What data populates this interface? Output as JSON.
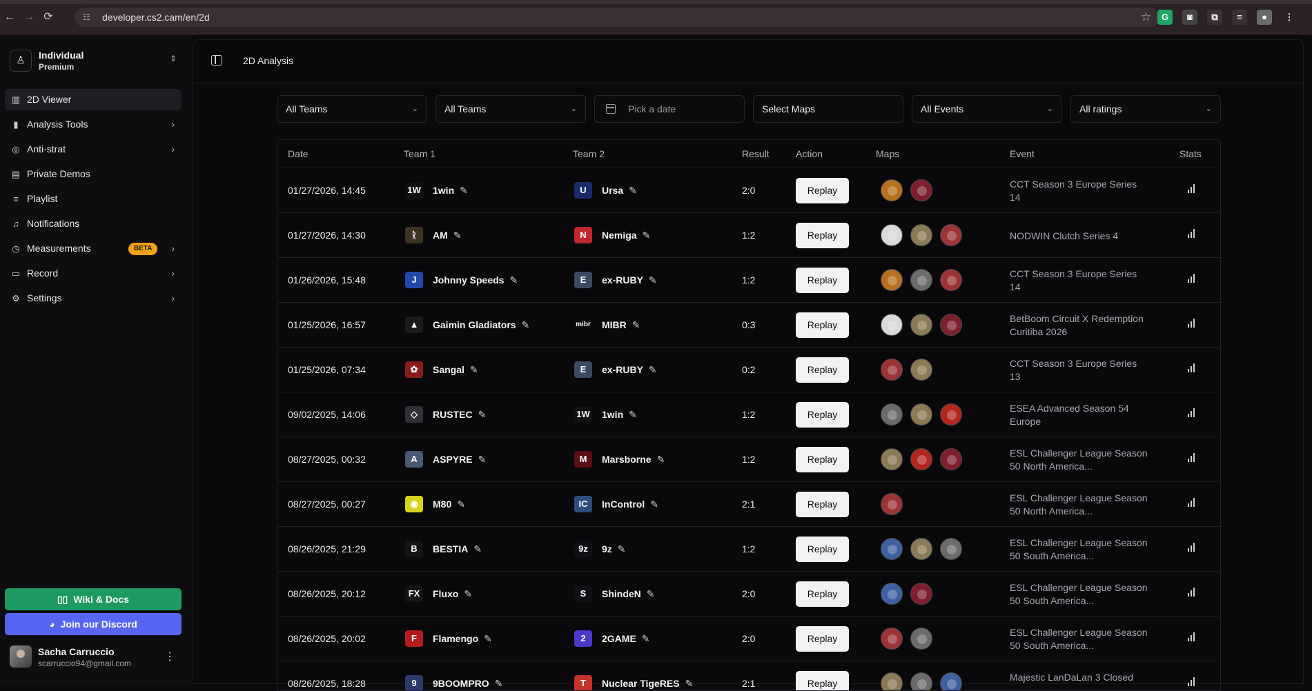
{
  "browser": {
    "url": "developer.cs2.cam/en/2d",
    "back_icon": "←",
    "forward_icon": "→",
    "reload_icon": "⟳",
    "extensions": [
      {
        "name": "grammarly-icon",
        "glyph": "G",
        "color": "#1fa463"
      },
      {
        "name": "extension-shield-icon",
        "glyph": "◙",
        "color": "#444444"
      },
      {
        "name": "puzzle-icon",
        "glyph": "⧉",
        "color": "#3a2f33"
      },
      {
        "name": "media-icon",
        "glyph": "≡",
        "color": "#3a2f33"
      },
      {
        "name": "profile-icon",
        "glyph": "●",
        "color": "#6a6a6a"
      },
      {
        "name": "kebab-icon",
        "glyph": "⋮",
        "color": "#2a2225"
      }
    ]
  },
  "account": {
    "name": "Individual",
    "plan": "Premium"
  },
  "menu": [
    {
      "label": "2D Viewer",
      "icon": "▥",
      "icon_name": "map-icon",
      "active": true,
      "arrow": false
    },
    {
      "label": "Analysis Tools",
      "icon": "▮",
      "icon_name": "chart-icon",
      "active": false,
      "arrow": true
    },
    {
      "label": "Anti-strat",
      "icon": "◎",
      "icon_name": "target-icon",
      "active": false,
      "arrow": true
    },
    {
      "label": "Private Demos",
      "icon": "▤",
      "icon_name": "document-icon",
      "active": false,
      "arrow": false
    },
    {
      "label": "Playlist",
      "icon": "≡",
      "icon_name": "playlist-icon",
      "active": false,
      "arrow": false
    },
    {
      "label": "Notifications",
      "icon": "♫",
      "icon_name": "bell-icon",
      "active": false,
      "arrow": false
    },
    {
      "label": "Measurements",
      "icon": "◷",
      "icon_name": "timer-icon",
      "active": false,
      "arrow": true,
      "badge": "BETA"
    },
    {
      "label": "Record",
      "icon": "▭",
      "icon_name": "video-icon",
      "active": false,
      "arrow": true
    },
    {
      "label": "Settings",
      "icon": "⚙",
      "icon_name": "settings-icon",
      "active": false,
      "arrow": true
    }
  ],
  "wiki_label": "Wiki & Docs",
  "discord_label": "Join our Discord",
  "user": {
    "name": "Sacha Carruccio",
    "email": "scarruccio94@gmail.com"
  },
  "page_title": "2D Analysis",
  "filters": {
    "team1": "All Teams",
    "team2": "All Teams",
    "date_placeholder": "Pick a date",
    "maps": "Select Maps",
    "events": "All Events",
    "ratings": "All ratings"
  },
  "table": {
    "headers": {
      "date": "Date",
      "team1": "Team 1",
      "team2": "Team 2",
      "result": "Result",
      "action": "Action",
      "maps": "Maps",
      "event": "Event",
      "stats": "Stats"
    },
    "replay_label": "Replay",
    "rows": [
      {
        "date": "01/27/2026, 14:45",
        "team1": "1win",
        "t1logo": "1W",
        "t1color": "#111111",
        "team2": "Ursa",
        "t2logo": "U",
        "t2color": "#1b2a6b",
        "result": "2:0",
        "maps": [
          "#b7701f",
          "#7d1f2c"
        ],
        "event": "CCT Season 3 Europe Series 14"
      },
      {
        "date": "01/27/2026, 14:30",
        "team1": "AM",
        "t1logo": "ᚱ",
        "t1color": "#3d3322",
        "team2": "Nemiga",
        "t2logo": "N",
        "t2color": "#c1272d",
        "result": "1:2",
        "maps": [
          "#d9d9d9",
          "#8a7a55",
          "#9c3336"
        ],
        "event": "NODWIN Clutch Series 4"
      },
      {
        "date": "01/26/2026, 15:48",
        "team1": "Johnny Speeds",
        "t1logo": "J",
        "t1color": "#2347a8",
        "team2": "ex-RUBY",
        "t2logo": "E",
        "t2color": "#3b4a63",
        "result": "1:2",
        "maps": [
          "#b7701f",
          "#6b6b6b",
          "#9c3336"
        ],
        "event": "CCT Season 3 Europe Series 14"
      },
      {
        "date": "01/25/2026, 16:57",
        "team1": "Gaimin Gladiators",
        "t1logo": "▲",
        "t1color": "#1a1a1a",
        "team2": "MIBR",
        "t2logo": "mibr",
        "t2color": "#0a0a0a",
        "result": "0:3",
        "maps": [
          "#d9d9d9",
          "#8a7a55",
          "#7d1f2c"
        ],
        "event": "BetBoom Circuit X Redemption Curitiba 2026"
      },
      {
        "date": "01/25/2026, 07:34",
        "team1": "Sangal",
        "t1logo": "✿",
        "t1color": "#8a1c1c",
        "team2": "ex-RUBY",
        "t2logo": "E",
        "t2color": "#3b4a63",
        "result": "0:2",
        "maps": [
          "#9c3336",
          "#8a7a55"
        ],
        "event": "CCT Season 3 Europe Series 13"
      },
      {
        "date": "09/02/2025, 14:06",
        "team1": "RUSTEC",
        "t1logo": "◇",
        "t1color": "#303036",
        "team2": "1win",
        "t2logo": "1W",
        "t2color": "#111111",
        "result": "1:2",
        "maps": [
          "#6b6b6b",
          "#8a7a55",
          "#b3261e"
        ],
        "event": "ESEA Advanced Season 54 Europe"
      },
      {
        "date": "08/27/2025, 00:32",
        "team1": "ASPYRE",
        "t1logo": "A",
        "t1color": "#4a5876",
        "team2": "Marsborne",
        "t2logo": "M",
        "t2color": "#5a0f14",
        "result": "1:2",
        "maps": [
          "#8a7a55",
          "#b3261e",
          "#7d1f2c"
        ],
        "event": "ESL Challenger League Season 50 North America..."
      },
      {
        "date": "08/27/2025, 00:27",
        "team1": "M80",
        "t1logo": "◉",
        "t1color": "#d7d21a",
        "team2": "InControl",
        "t2logo": "IC",
        "t2color": "#2f4c7a",
        "result": "2:1",
        "maps": [
          "#9c3336"
        ],
        "event": "ESL Challenger League Season 50 North America..."
      },
      {
        "date": "08/26/2025, 21:29",
        "team1": "BESTIA",
        "t1logo": "B",
        "t1color": "#141414",
        "team2": "9z",
        "t2logo": "9z",
        "t2color": "#101014",
        "result": "1:2",
        "maps": [
          "#3f5fa1",
          "#8a7a55",
          "#6b6b6b"
        ],
        "event": "ESL Challenger League Season 50 South America..."
      },
      {
        "date": "08/26/2025, 20:12",
        "team1": "Fluxo",
        "t1logo": "FX",
        "t1color": "#141414",
        "team2": "ShindeN",
        "t2logo": "S",
        "t2color": "#101014",
        "result": "2:0",
        "maps": [
          "#3f5fa1",
          "#7d1f2c"
        ],
        "event": "ESL Challenger League Season 50 South America..."
      },
      {
        "date": "08/26/2025, 20:02",
        "team1": "Flamengo",
        "t1logo": "F",
        "t1color": "#b31d1d",
        "team2": "2GAME",
        "t2logo": "2",
        "t2color": "#4b37c9",
        "result": "2:0",
        "maps": [
          "#9c3336",
          "#6b6b6b"
        ],
        "event": "ESL Challenger League Season 50 South America..."
      },
      {
        "date": "08/26/2025, 18:28",
        "team1": "9BOOMPRO",
        "t1logo": "9",
        "t1color": "#2b3a6b",
        "team2": "Nuclear TigeRES",
        "t2logo": "T",
        "t2color": "#c2332b",
        "result": "2:1",
        "maps": [
          "#8a7a55",
          "#6b6b6b",
          "#3f5fa1"
        ],
        "event": "Majestic LanDaLan 3 Closed"
      }
    ]
  }
}
